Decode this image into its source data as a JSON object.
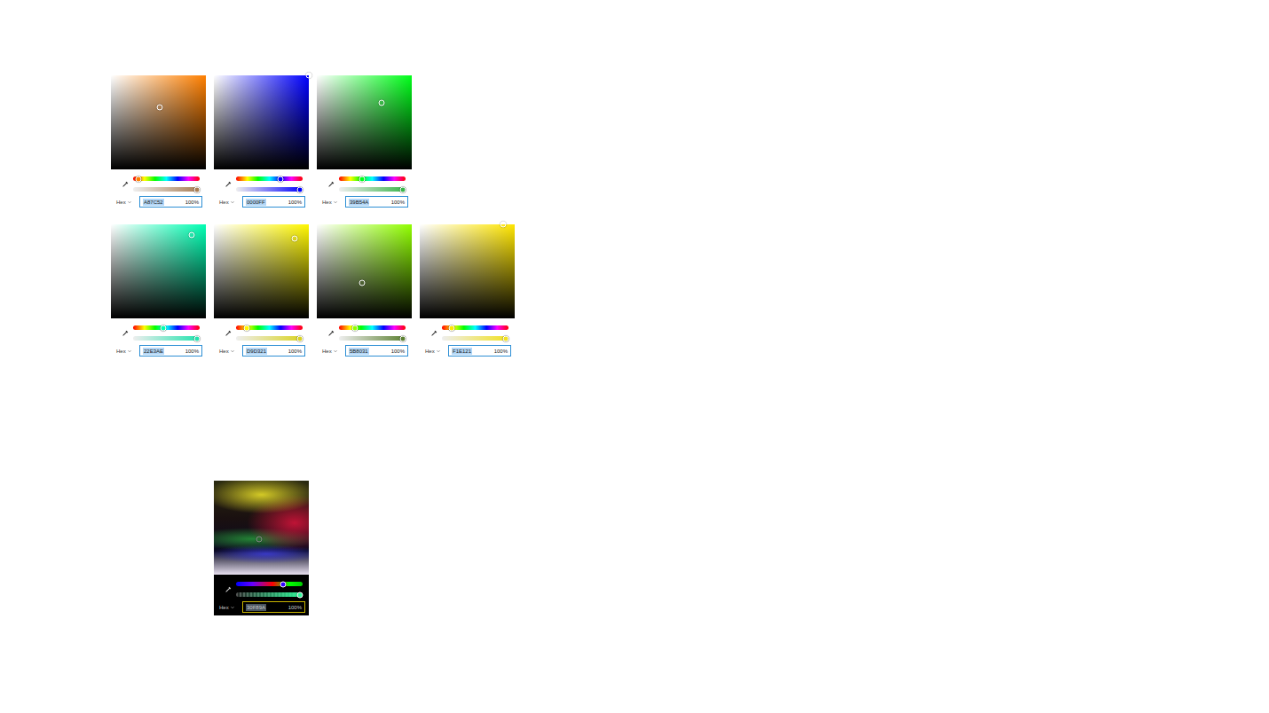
{
  "pickers": [
    {
      "kind": "light",
      "hue": 0.083,
      "saturation": 0.51,
      "value": 0.66,
      "alpha": 1,
      "format": "Hex",
      "hex": "A87C52",
      "hex_selected": true,
      "opacity": "100%"
    },
    {
      "kind": "light",
      "hue": 0.667,
      "saturation": 1,
      "value": 1,
      "alpha": 1,
      "format": "Hex",
      "hex": "0000FF",
      "hex_selected": true,
      "opacity": "100%"
    },
    {
      "kind": "light",
      "hue": 0.35,
      "saturation": 0.68,
      "value": 0.71,
      "alpha": 1,
      "format": "Hex",
      "hex": "39B54A",
      "hex_selected": true,
      "opacity": "100%"
    },
    {
      "kind": "light",
      "hue": 0.45,
      "saturation": 0.85,
      "value": 0.89,
      "alpha": 1,
      "format": "Hex",
      "hex": "22E3AE",
      "hex_selected": true,
      "opacity": "100%"
    },
    {
      "kind": "light",
      "hue": 0.16,
      "saturation": 0.85,
      "value": 0.85,
      "alpha": 1,
      "format": "Hex",
      "hex": "D9D321",
      "hex_selected": true,
      "opacity": "100%"
    },
    {
      "kind": "light",
      "hue": 0.24,
      "saturation": 0.48,
      "value": 0.38,
      "alpha": 1,
      "format": "Hex",
      "hex": "5B8031",
      "hex_selected": true,
      "opacity": "100%"
    },
    {
      "kind": "light",
      "hue": 0.15,
      "saturation": 0.88,
      "value": 1,
      "alpha": 1,
      "format": "Hex",
      "hex": "F1E121",
      "hex_selected": true,
      "opacity": "100%"
    },
    {
      "kind": "dark",
      "hue": 0.7,
      "saturation": 0.48,
      "value": 0.38,
      "alpha": 1,
      "format": "Hex",
      "hex": "30F89A",
      "hex_selected": true,
      "opacity": "100%"
    }
  ]
}
